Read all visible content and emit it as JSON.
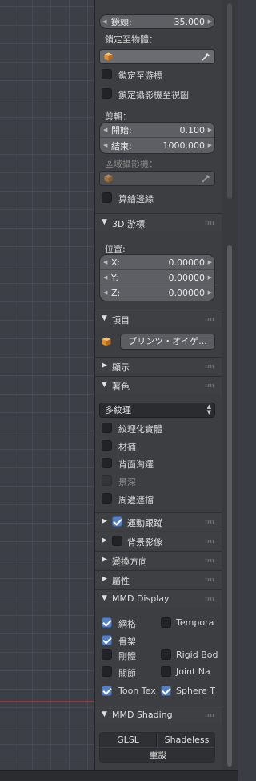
{
  "camera": {
    "lens_label": "鏡頭:",
    "lens_value": "35.000",
    "lock_to_object_label": "鎖定至物體：",
    "lock_to_cursor_label": "鎖定至游標",
    "lock_camera_to_view_label": "鎖定攝影機至視圖",
    "clip_label": "剪輯：",
    "clip_start_label": "開始:",
    "clip_start_value": "0.100",
    "clip_end_label": "結束:",
    "clip_end_value": "1000.000",
    "local_camera_label": "區域攝影機：",
    "render_border_label": "算繪邊緣"
  },
  "cursor": {
    "title": "3D 游標",
    "location_label": "位置:",
    "x_label": "X:",
    "x_value": "0.00000",
    "y_label": "Y:",
    "y_value": "0.00000",
    "z_label": "Z:",
    "z_value": "0.00000"
  },
  "item": {
    "title": "項目",
    "object_name": "プリンツ・オイゲ..."
  },
  "display": {
    "title": "顯示"
  },
  "shading": {
    "title": "著色",
    "mode_value": "多紋理",
    "textured_solid_label": "紋理化實體",
    "matcap_label": "材補",
    "backface_culling_label": "背面淘選",
    "depth_of_field_label": "景深",
    "ambient_occlusion_label": "周遭遮擋"
  },
  "motion_tracking": {
    "title": "運動跟蹤",
    "enabled": true
  },
  "background_images": {
    "title": "背景影像",
    "enabled": false
  },
  "transform_orientations": {
    "title": "變換方向"
  },
  "properties": {
    "title": "屬性"
  },
  "mmd_display": {
    "title": "MMD Display",
    "mesh_label": "網格",
    "mesh_checked": true,
    "temporary_label": "Tempora",
    "temporary_checked": false,
    "armature_label": "骨架",
    "armature_checked": true,
    "rigid_body_cn_label": "剛體",
    "rigid_body_cn_checked": false,
    "rigid_body_label": "Rigid Bod",
    "rigid_body_checked": false,
    "joint_cn_label": "關節",
    "joint_cn_checked": false,
    "joint_name_label": "Joint Na",
    "joint_name_checked": false,
    "toon_texture_label": "Toon Tex",
    "toon_texture_checked": true,
    "sphere_texture_label": "Sphere T",
    "sphere_texture_checked": true
  },
  "mmd_shading": {
    "title": "MMD Shading",
    "glsl_label": "GLSL",
    "shadeless_label": "Shadeless",
    "reset_label": "重設"
  },
  "icons": {
    "expanded": "▼",
    "collapsed": "▶",
    "cube": "cube-icon",
    "eyedropper": "eyedropper-icon"
  },
  "colors": {
    "panel_bg": "#3d3e42",
    "checkbox_on": "#5680c2",
    "field_bg": "#5d5f64"
  }
}
